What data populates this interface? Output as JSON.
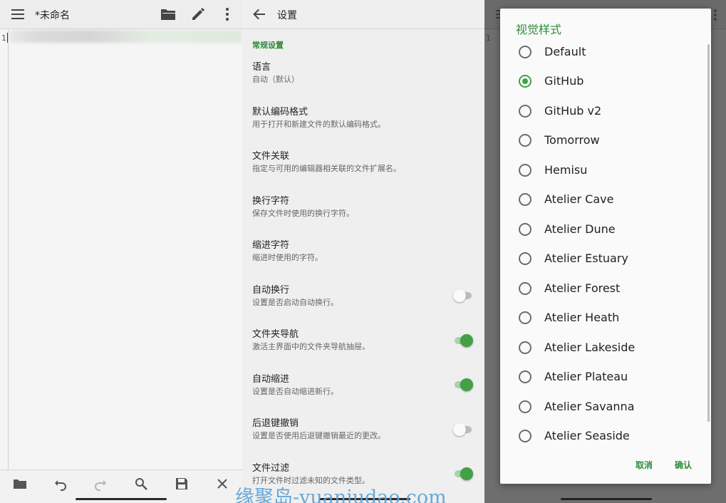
{
  "editor": {
    "title": "*未命名",
    "menu_icon": "menu-icon",
    "line_number": "1",
    "toolbar_icons": [
      "folder-open-icon",
      "pencil-icon",
      "more-vert-icon"
    ],
    "bottom_icons": [
      "folder-icon",
      "undo-icon",
      "redo-icon",
      "search-icon",
      "save-icon",
      "close-icon"
    ]
  },
  "settings": {
    "title": "设置",
    "section": "常规设置",
    "items": [
      {
        "title": "语言",
        "subtitle": "自动（默认）"
      },
      {
        "title": "默认编码格式",
        "subtitle": "用于打开和新建文件的默认编码格式。"
      },
      {
        "title": "文件关联",
        "subtitle": "指定与可用的编辑器相关联的文件扩展名。"
      },
      {
        "title": "换行字符",
        "subtitle": "保存文件时使用的换行字符。"
      },
      {
        "title": "缩进字符",
        "subtitle": "缩进时使用的字符。"
      },
      {
        "title": "自动换行",
        "subtitle": "设置是否启动自动换行。",
        "toggle": false
      },
      {
        "title": "文件夹导航",
        "subtitle": "激活主界面中的文件夹导航抽屉。",
        "toggle": true
      },
      {
        "title": "自动缩进",
        "subtitle": "设置是否自动缩进新行。",
        "toggle": true
      },
      {
        "title": "后退键撤销",
        "subtitle": "设置是否使用后退键撤销最近的更改。",
        "toggle": false
      },
      {
        "title": "文件过滤",
        "subtitle": "打开文件时过滤未知的文件类型。",
        "toggle": true
      }
    ]
  },
  "dialog": {
    "title": "视觉样式",
    "selected": "GitHub",
    "options": [
      "Default",
      "GitHub",
      "GitHub v2",
      "Tomorrow",
      "Hemisu",
      "Atelier Cave",
      "Atelier Dune",
      "Atelier Estuary",
      "Atelier Forest",
      "Atelier Heath",
      "Atelier Lakeside",
      "Atelier Plateau",
      "Atelier Savanna",
      "Atelier Seaside"
    ],
    "cancel": "取消",
    "confirm": "确认"
  },
  "watermark": "缘聚岛-yuanjudao.com",
  "colors": {
    "accent": "#43a047",
    "accent_text": "#2e8b3c",
    "watermark": "#5ba3d9"
  }
}
